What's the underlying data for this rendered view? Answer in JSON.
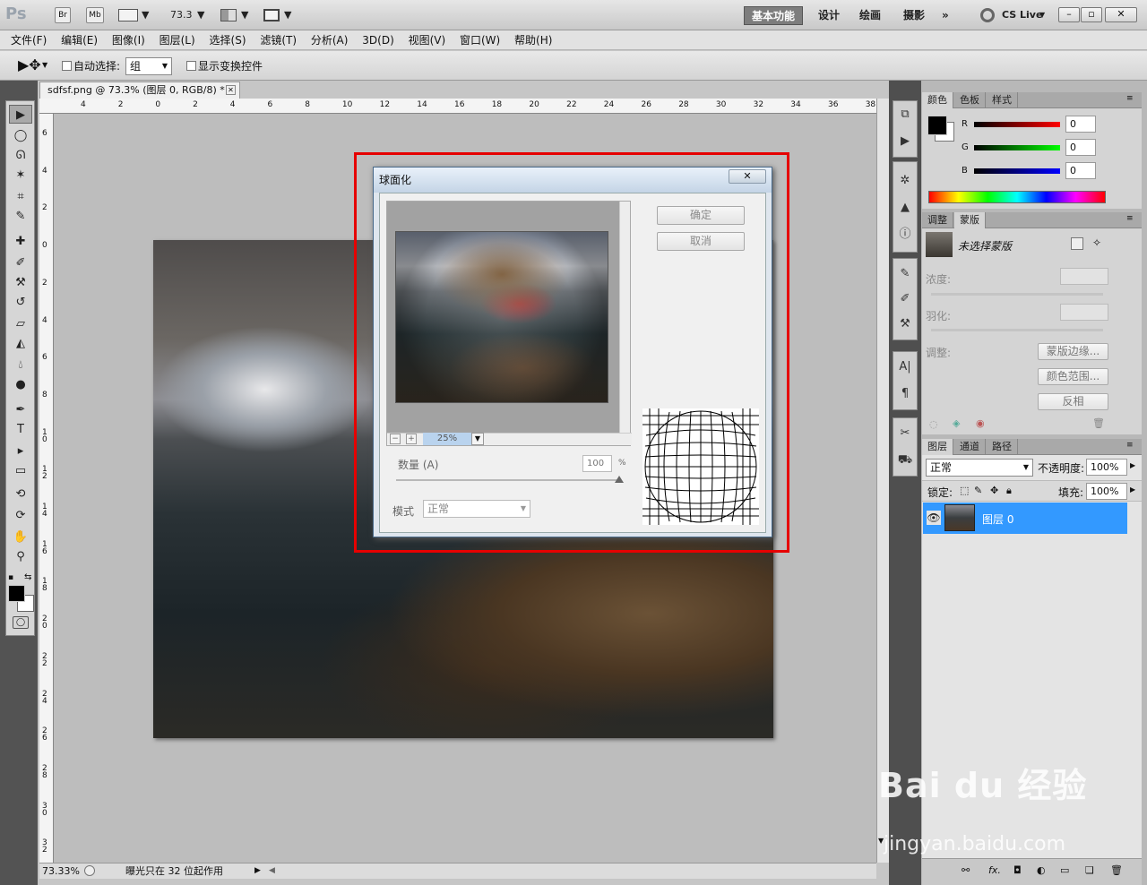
{
  "titlebar": {
    "logo": "Ps",
    "bridge": "Br",
    "minibridge": "Mb",
    "zoom_value": "73.3",
    "workspaces": [
      "基本功能",
      "设计",
      "绘画",
      "摄影"
    ],
    "more": "»",
    "cslive": "CS Live",
    "window_buttons": [
      "–",
      "▫",
      "✕"
    ]
  },
  "menu": [
    "文件(F)",
    "编辑(E)",
    "图像(I)",
    "图层(L)",
    "选择(S)",
    "滤镜(T)",
    "分析(A)",
    "3D(D)",
    "视图(V)",
    "窗口(W)",
    "帮助(H)"
  ],
  "options": {
    "auto_select_label": "自动选择:",
    "auto_select_value": "组",
    "show_transform_label": "显示变换控件"
  },
  "document": {
    "tab_title": "sdfsf.png @ 73.3% (图层 0, RGB/8) *",
    "ruler_top": [
      "4",
      "2",
      "0",
      "2",
      "4",
      "6",
      "8",
      "10",
      "12",
      "14",
      "16",
      "18",
      "20",
      "22",
      "24",
      "26",
      "28",
      "30",
      "32",
      "34",
      "36",
      "38"
    ],
    "ruler_left": [
      "6",
      "4",
      "2",
      "0",
      "2",
      "4",
      "6",
      "8",
      "1\n0",
      "1\n2",
      "1\n4",
      "1\n6",
      "1\n8",
      "2\n0",
      "2\n2",
      "2\n4",
      "2\n6",
      "2\n8",
      "3\n0",
      "3\n2"
    ]
  },
  "status": {
    "zoom": "73.33%",
    "message": "曝光只在 32 位起作用"
  },
  "dialog": {
    "title": "球面化",
    "ok": "确定",
    "cancel": "取消",
    "zoom_pct": "25%",
    "amount_label": "数量 (A)",
    "amount_value": "100",
    "amount_unit": "%",
    "mode_label": "模式",
    "mode_value": "正常"
  },
  "color_panel": {
    "tabs": [
      "颜色",
      "色板",
      "样式"
    ],
    "r_label": "R",
    "r_value": "0",
    "g_label": "G",
    "g_value": "0",
    "b_label": "B",
    "b_value": "0"
  },
  "mask_panel": {
    "tabs": [
      "调整",
      "蒙版"
    ],
    "no_mask": "未选择蒙版",
    "density_label": "浓度:",
    "feather_label": "羽化:",
    "adjust_label": "调整:",
    "mask_edge": "蒙版边缘...",
    "color_range": "颜色范围...",
    "invert": "反相"
  },
  "layers_panel": {
    "tabs": [
      "图层",
      "通道",
      "路径"
    ],
    "blend_mode": "正常",
    "opacity_label": "不透明度:",
    "opacity_value": "100%",
    "lock_label": "锁定:",
    "fill_label": "填充:",
    "fill_value": "100%",
    "layer_name": "图层 0",
    "footer_fx": "fx."
  },
  "watermark": {
    "brand": "Bai du 经验",
    "url": "jingyan.baidu.com"
  },
  "colors": {
    "highlight": "#e60000",
    "layer_selected": "#3399ff"
  }
}
